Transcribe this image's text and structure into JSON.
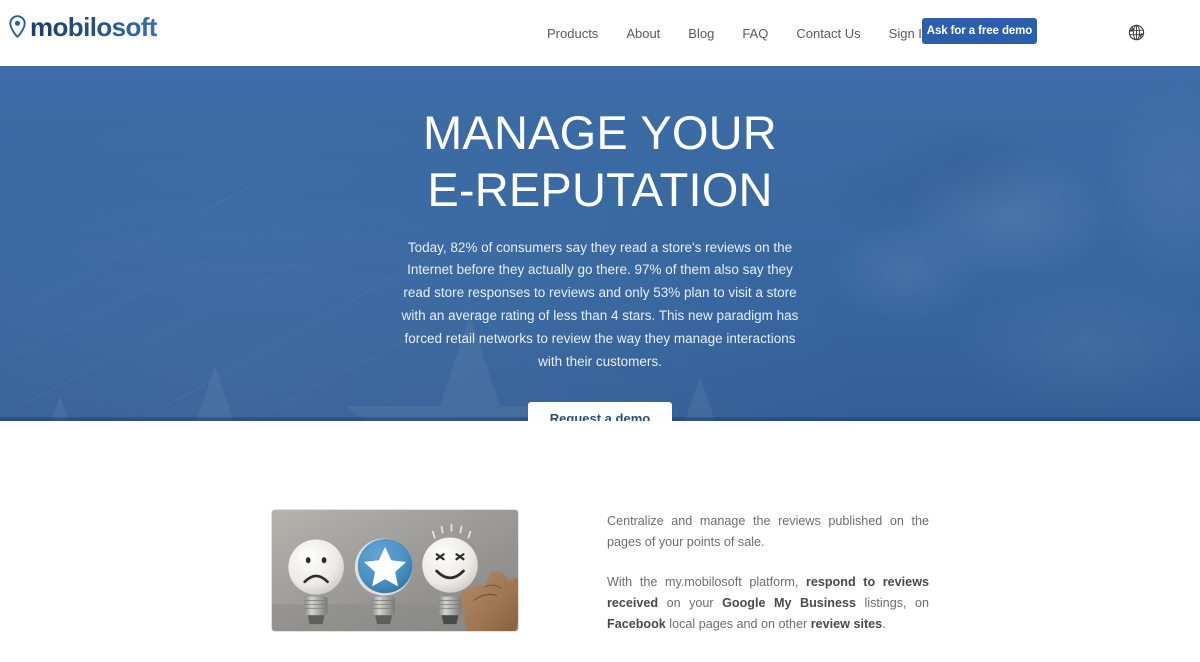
{
  "header": {
    "logo": {
      "icon": "location-pin-icon",
      "text": "mobilosoft",
      "color_dark": "#1d3f6e",
      "color_light": "#3a6fb4"
    },
    "nav": [
      {
        "label": "Products"
      },
      {
        "label": "About"
      },
      {
        "label": "Blog"
      },
      {
        "label": "FAQ"
      },
      {
        "label": "Contact Us"
      },
      {
        "label": "Sign In"
      }
    ],
    "cta": {
      "label": "Ask for a free demo",
      "background": "#2c5fab",
      "text_color": "#ffffff"
    },
    "language_switch": {
      "icon": "globe-icon"
    }
  },
  "hero": {
    "background_color": "#37669f",
    "title_line1": "MANAGE YOUR",
    "title_line2": "E-REPUTATION",
    "paragraph": "Today, 82% of consumers say they read a store's reviews on the Internet before they actually go there. 97% of them also say they read store responses to reviews and only 53% plan to visit a store with an average rating of less than 4 stars. This new paradigm has forced retail networks to review the way they manage interactions with their customers.",
    "stats": {
      "read_reviews_before_visit": "82%",
      "read_store_responses": "97%",
      "plan_to_visit_low_rated": "53%",
      "rating_threshold_stars": "4"
    },
    "button": {
      "label": "Request a demo",
      "background": "#fdfdfd",
      "text_color": "#2b4f7d"
    }
  },
  "content": {
    "image": {
      "alt": "three-lightbulbs-rating-photo",
      "bulbs": [
        "sad-face-bulb",
        "blue-star-bulb",
        "happy-face-bulb"
      ],
      "accent_color": "#4a90c4"
    },
    "paragraph1": {
      "text": "Centralize and manage the reviews published on the pages of your points of sale."
    },
    "paragraph2": {
      "part1": "With the my.mobilosoft platform, ",
      "bold1": "respond to reviews received",
      "part2": " on your ",
      "bold2": "Google My Business",
      "part3": " listings, on ",
      "bold3": "Facebook",
      "part4": " local pages and on other ",
      "bold4": "review sites",
      "part5": "."
    }
  }
}
